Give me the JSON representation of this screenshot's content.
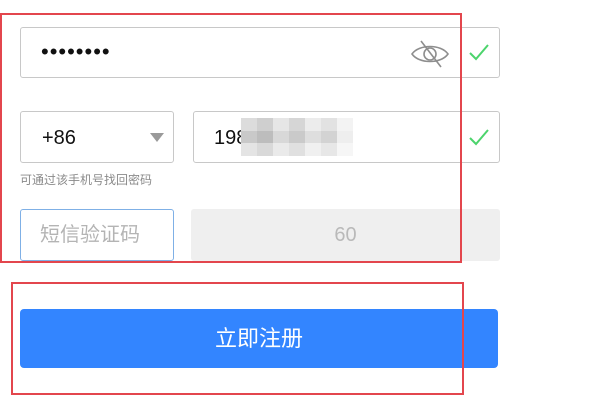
{
  "password": {
    "value": "••••••••",
    "icon": "eye-slash-icon"
  },
  "phone": {
    "country_code": "+86",
    "number_visible": "198",
    "hint": "可通过该手机号找回密码"
  },
  "sms": {
    "placeholder": "短信验证码",
    "countdown": "60"
  },
  "register": {
    "label": "立即注册"
  },
  "colors": {
    "primary": "#3385ff",
    "check": "#4cd46c",
    "highlight": "#e3464d"
  }
}
